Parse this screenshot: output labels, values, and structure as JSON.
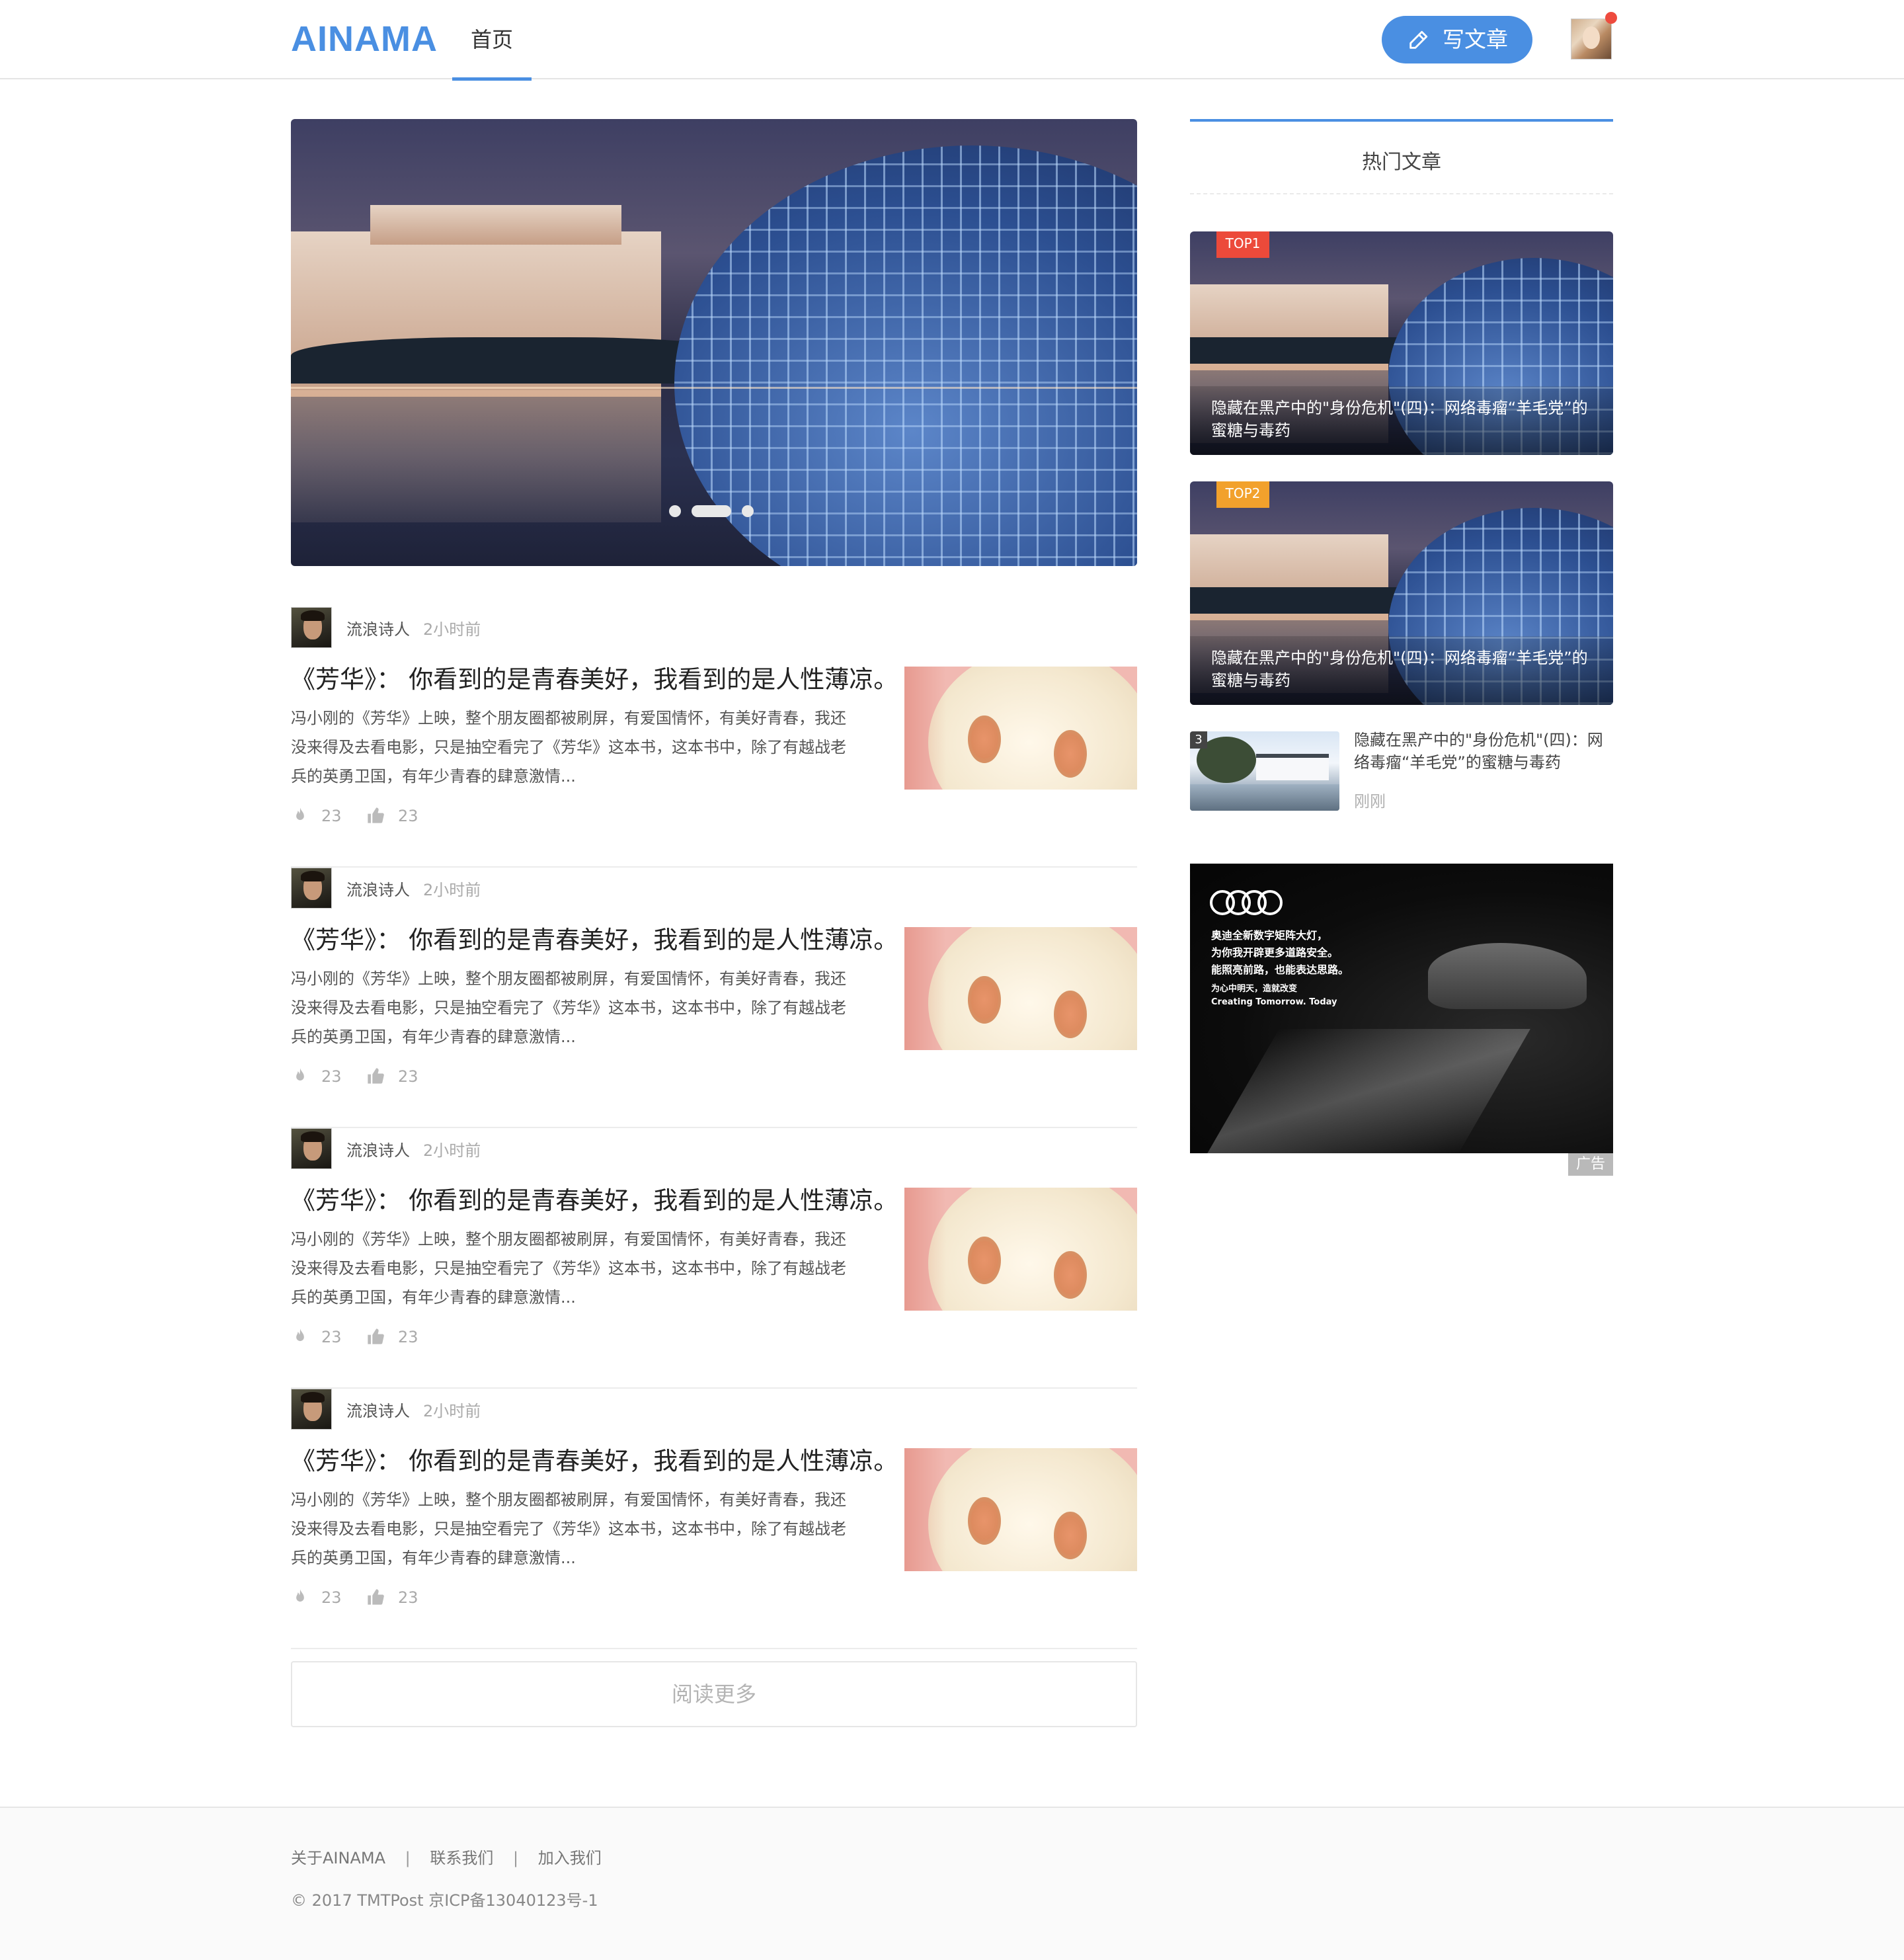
{
  "header": {
    "logo": "AINAMA",
    "nav_home": "首页",
    "write_button": "写文章"
  },
  "carousel": {
    "slide_count": 3,
    "active_index": 1
  },
  "articles": [
    {
      "author": "流浪诗人",
      "time": "2小时前",
      "title": "《芳华》： 你看到的是青春美好，我看到的是人性薄凉。",
      "desc": "冯小刚的《芳华》上映，整个朋友圈都被刷屏，有爱国情怀，有美好青春，我还没来得及去看电影，只是抽空看完了《芳华》这本书，这本书中，除了有越战老兵的英勇卫国，有年少青春的肆意激情...",
      "views": "23",
      "likes": "23"
    },
    {
      "author": "流浪诗人",
      "time": "2小时前",
      "title": "《芳华》： 你看到的是青春美好，我看到的是人性薄凉。",
      "desc": "冯小刚的《芳华》上映，整个朋友圈都被刷屏，有爱国情怀，有美好青春，我还没来得及去看电影，只是抽空看完了《芳华》这本书，这本书中，除了有越战老兵的英勇卫国，有年少青春的肆意激情...",
      "views": "23",
      "likes": "23"
    },
    {
      "author": "流浪诗人",
      "time": "2小时前",
      "title": "《芳华》： 你看到的是青春美好，我看到的是人性薄凉。",
      "desc": "冯小刚的《芳华》上映，整个朋友圈都被刷屏，有爱国情怀，有美好青春，我还没来得及去看电影，只是抽空看完了《芳华》这本书，这本书中，除了有越战老兵的英勇卫国，有年少青春的肆意激情...",
      "views": "23",
      "likes": "23"
    },
    {
      "author": "流浪诗人",
      "time": "2小时前",
      "title": "《芳华》： 你看到的是青春美好，我看到的是人性薄凉。",
      "desc": "冯小刚的《芳华》上映，整个朋友圈都被刷屏，有爱国情怀，有美好青春，我还没来得及去看电影，只是抽空看完了《芳华》这本书，这本书中，除了有越战老兵的英勇卫国，有年少青春的肆意激情...",
      "views": "23",
      "likes": "23"
    }
  ],
  "read_more": "阅读更多",
  "sidebar": {
    "hot_title": "热门文章",
    "hot_cards": [
      {
        "tag": "TOP1",
        "title": "隐藏在黑产中的\"身份危机\"(四)：网络毒瘤“羊毛党”的蜜糖与毒药"
      },
      {
        "tag": "TOP2",
        "title": "隐藏在黑产中的\"身份危机\"(四)：网络毒瘤“羊毛党”的蜜糖与毒药"
      }
    ],
    "hot_small": {
      "rank": "3",
      "title": "隐藏在黑产中的\"身份危机\"(四)：网络毒瘤“羊毛党”的蜜糖与毒药",
      "time": "刚刚"
    },
    "ad": {
      "copy_lines": [
        "奥迪全新数字矩阵大灯，",
        "为你我开辟更多道路安全。",
        "能照亮前路，也能表达思路。"
      ],
      "sub_lines": [
        "为心中明天，造就改变",
        "Creating Tomorrow. Today"
      ],
      "label": "广告"
    }
  },
  "footer": {
    "links": [
      "关于AINAMA",
      "联系我们",
      "加入我们"
    ],
    "separator": "|",
    "copyright": "© 2017 TMTPost 京ICP备13040123号-1"
  },
  "colors": {
    "accent": "#4a8fe2",
    "top1_tag": "#ec4a3a",
    "top2_tag": "#f2a12c",
    "notification_dot": "#ee4b3e"
  }
}
